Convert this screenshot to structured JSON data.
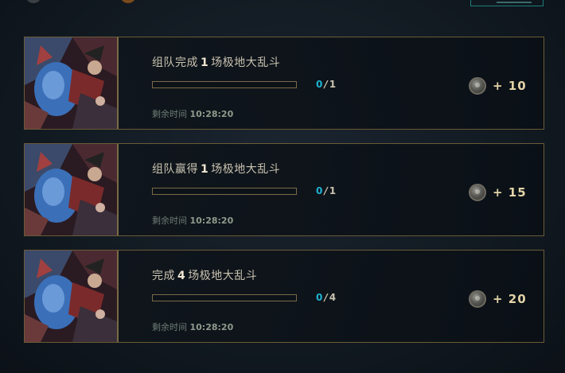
{
  "missions": [
    {
      "title_prefix": "组队完成",
      "title_count": "1",
      "title_suffix": "场极地大乱斗",
      "progress_current": "0",
      "progress_separator": "/",
      "progress_total": "1",
      "progress_fraction": 0,
      "timer_label": "剩余时间",
      "timer_value": "10:28:20",
      "reward_text": "+ 10",
      "reward_icon": "coin-icon"
    },
    {
      "title_prefix": "组队赢得",
      "title_count": "1",
      "title_suffix": "场极地大乱斗",
      "progress_current": "0",
      "progress_separator": "/",
      "progress_total": "1",
      "progress_fraction": 0,
      "timer_label": "剩余时间",
      "timer_value": "10:28:20",
      "reward_text": "+ 15",
      "reward_icon": "coin-icon"
    },
    {
      "title_prefix": "完成",
      "title_count": "4",
      "title_suffix": "场极地大乱斗",
      "progress_current": "0",
      "progress_separator": "/",
      "progress_total": "4",
      "progress_fraction": 0,
      "timer_label": "剩余时间",
      "timer_value": "10:28:20",
      "reward_text": "+ 20",
      "reward_icon": "coin-icon"
    }
  ],
  "colors": {
    "border_gold": "#6b5a37",
    "progress_current": "#1fb3d4",
    "reward_gold": "#e2d3a7"
  }
}
